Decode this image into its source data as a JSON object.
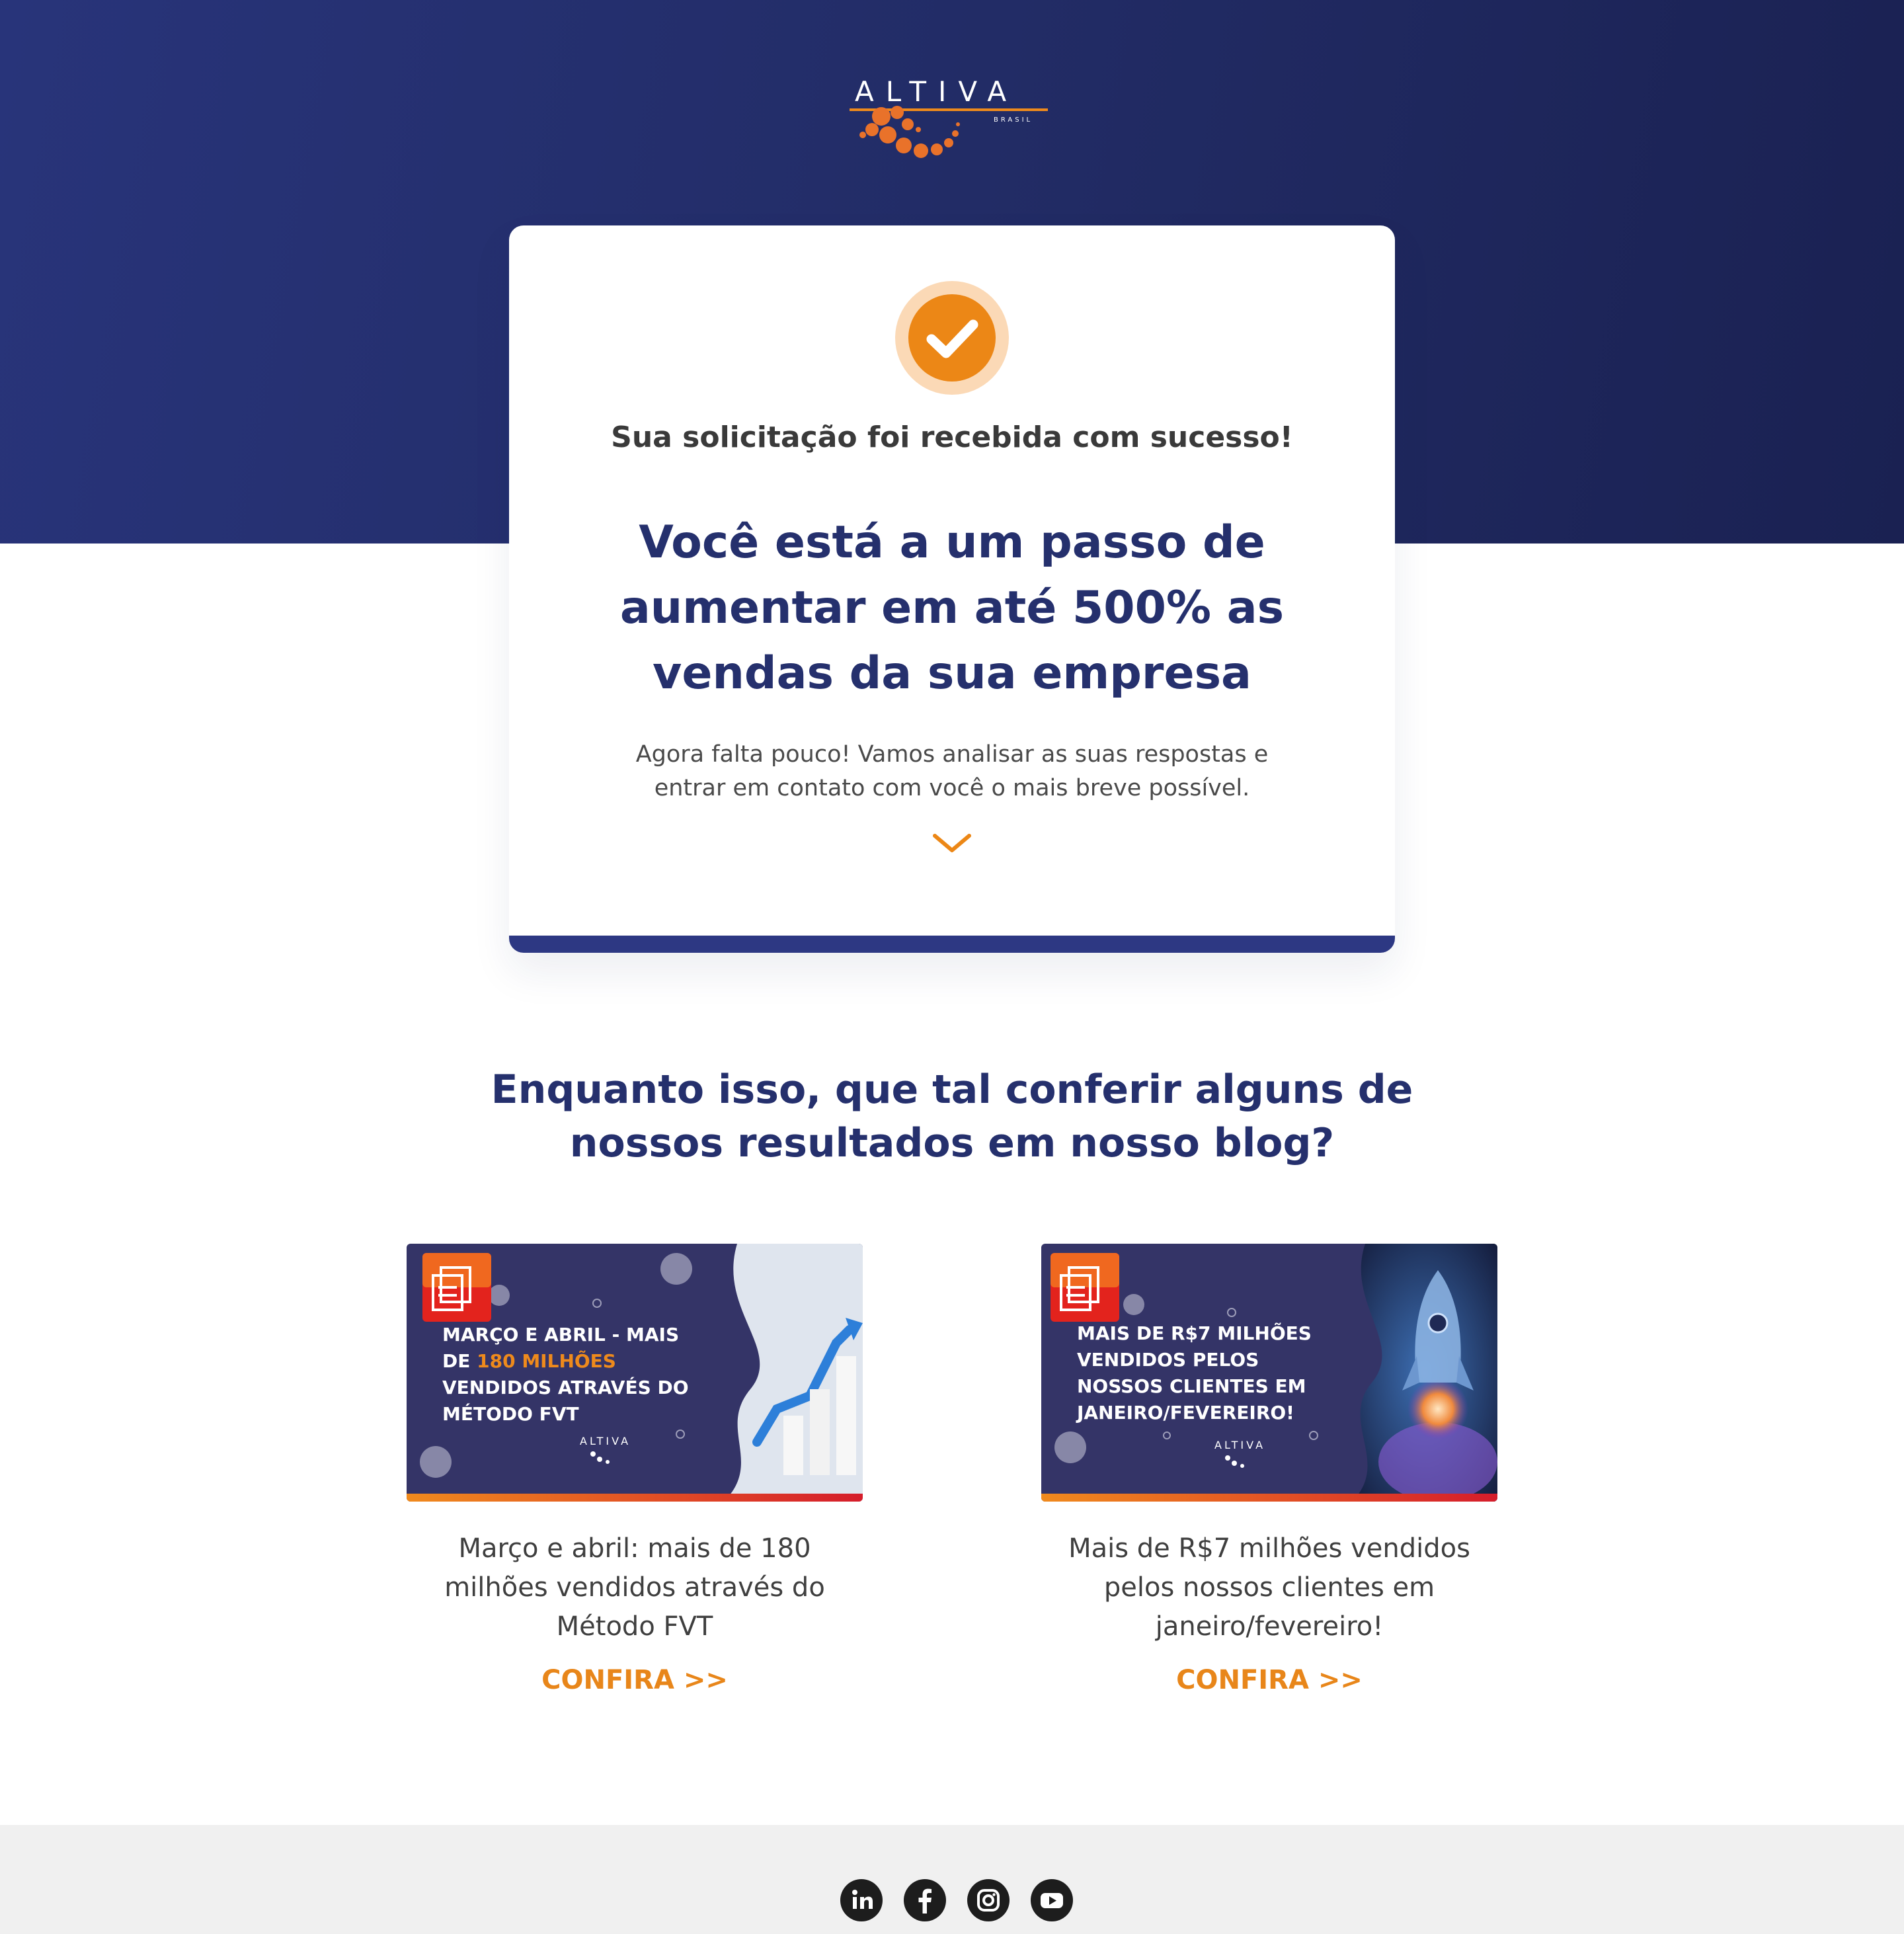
{
  "brand": {
    "logo_text": "ALTIVA",
    "logo_sub": "BRASIL",
    "orange": "#ee8a1c",
    "navy": "#25306d"
  },
  "card": {
    "check_icon": "check-circle-icon",
    "subtitle": "Sua solicitação foi recebida com sucesso!",
    "title": "Você está a um passo de aumentar em até 500% as vendas da sua empresa",
    "text": "Agora falta pouco! Vamos analisar as suas respostas e entrar em contato com você o mais breve possível.",
    "chevron_icon": "chevron-down-icon"
  },
  "blog_section": {
    "title": "Enquanto isso, que tal conferir alguns de nossos resultados em nosso blog?",
    "posts": [
      {
        "thumb_line1": "MARÇO E ABRIL - MAIS",
        "thumb_line2_prefix": "DE ",
        "thumb_highlight": "180 MILHÕES",
        "thumb_line3": "VENDIDOS ATRAVÉS DO",
        "thumb_line4": "MÉTODO FVT",
        "caption": "Março e abril: mais de 180 milhões vendidos através do Método FVT",
        "link": "CONFIRA >>"
      },
      {
        "thumb_line1": "MAIS DE R$7 MILHÕES",
        "thumb_line2": "VENDIDOS PELOS",
        "thumb_line3": "NOSSOS CLIENTES EM",
        "thumb_line4": "JANEIRO/FEVEREIRO!",
        "caption": "Mais de R$7 milhões vendidos pelos nossos clientes em janeiro/fevereiro!",
        "link": "CONFIRA >>"
      }
    ]
  },
  "footer": {
    "social_icons": [
      "linkedin-icon",
      "facebook-icon",
      "instagram-icon",
      "youtube-icon"
    ]
  }
}
